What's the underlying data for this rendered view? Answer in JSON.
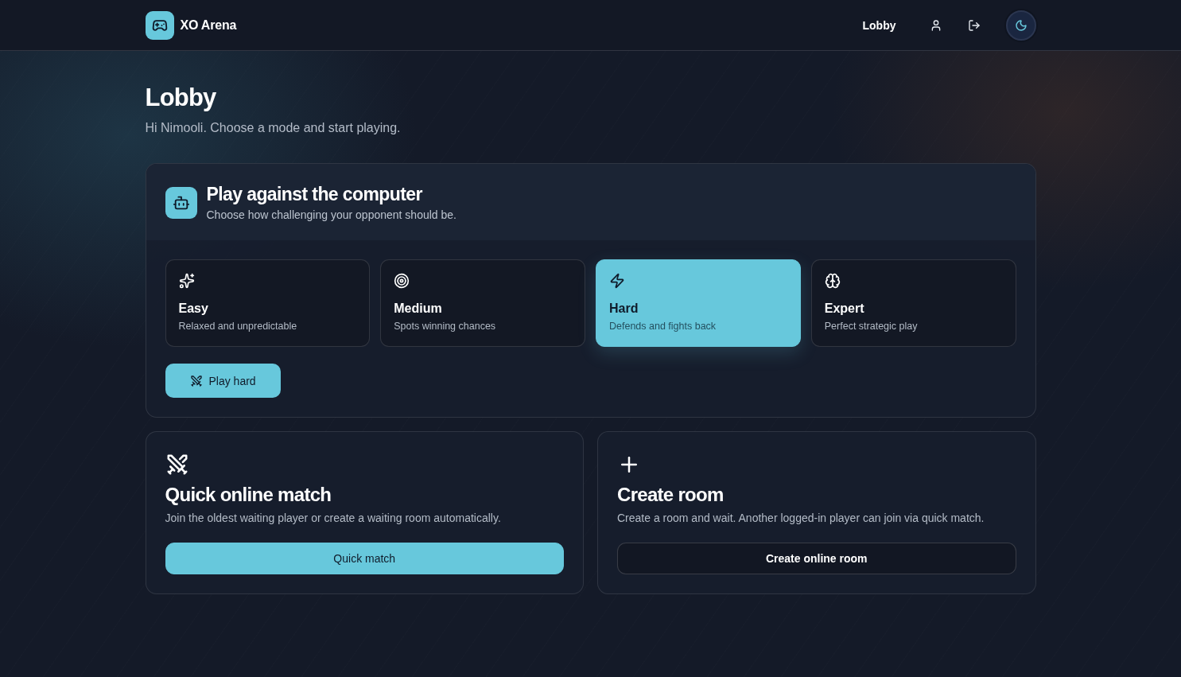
{
  "header": {
    "brand": "XO Arena",
    "nav_link": "Lobby"
  },
  "page": {
    "title": "Lobby",
    "subtitle": "Hi Nimooli. Choose a mode and start playing."
  },
  "computer_mode": {
    "title": "Play against the computer",
    "subtitle": "Choose how challenging your opponent should be.",
    "difficulties": [
      {
        "label": "Easy",
        "description": "Relaxed and unpredictable",
        "selected": false
      },
      {
        "label": "Medium",
        "description": "Spots winning chances",
        "selected": false
      },
      {
        "label": "Hard",
        "description": "Defends and fights back",
        "selected": true
      },
      {
        "label": "Expert",
        "description": "Perfect strategic play",
        "selected": false
      }
    ],
    "play_button": "Play hard"
  },
  "online_modes": [
    {
      "kind": "quick",
      "title": "Quick online match",
      "description": "Join the oldest waiting player or create a waiting room automatically.",
      "button": "Quick match"
    },
    {
      "kind": "create",
      "title": "Create room",
      "description": "Create a room and wait. Another logged-in player can join via quick match.",
      "button": "Create online room"
    }
  ]
}
